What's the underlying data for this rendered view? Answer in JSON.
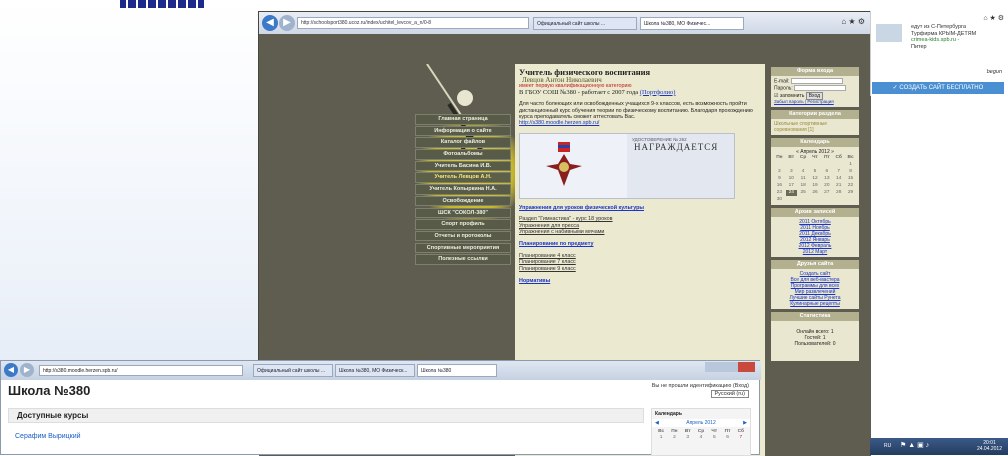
{
  "browser_main": {
    "url": "http://schoolsport380.ucoz.ru/index/uchitel_levcov_a_n/0-8",
    "tabs": [
      "Официальный сайт школы ...",
      "Школа №380, МО Физичес..."
    ],
    "page": {
      "menu": [
        "Главная страница",
        "Информация о сайте",
        "Каталог файлов",
        "Фотоальбомы",
        "Учитель Басина И.В.",
        "Учитель Левцов А.Н.",
        "Учитель Копыркина Н.А.",
        "Освобождение",
        "ШСК \"СОКОЛ-380\"",
        "Спорт профиль",
        "Отчеты и протоколы",
        "Спортивные мероприятия",
        "Полезные ссылки"
      ],
      "heading": "Учитель физического воспитания",
      "name": "Левцов Антон Николаевич",
      "category": "имеет первую квалификационную категорию",
      "work": "В ГБОУ СОШ №380 - работает с 2007 года",
      "portfolio": "(Портфолио)",
      "intro": "Для часто болеющих или освобожденных учащихся 9-х классов, есть возможность пройти дистанционный курс обучения теории по физическому воспитанию. Благодаря прохождению курса преподаватель сможет аттестовать Вас.",
      "moodle_link": "http://s380.moodle.herzen.spb.ru/",
      "cert_title": "НАГРАЖДАЕТСЯ",
      "cert_small": "УДОСТОВЕРЕНИЕ № 262",
      "section1": "Упражнения для уроков физической культуры",
      "links1": [
        "Раздел \"Гимнастика\" - курс 18 уроков",
        "Упражнения для пресса",
        "Упражнения с набивными мячами"
      ],
      "section2": "Планирование по предмету",
      "links2": [
        "Планирование 4 класс",
        "Планирование 7 класс",
        "Планирование 9 класс"
      ],
      "section3": "Нормативы"
    },
    "sidebar": {
      "login_header": "Форма входа",
      "email_label": "E-mail:",
      "password_label": "Пароль:",
      "remember": "запомнить",
      "login_btn": "Вход",
      "forgot": "Забыл пароль | Регистрация",
      "cat_header": "Категории раздела",
      "cat_item": "Школьные спортивные соревнования [1]",
      "cal_header": "Календарь",
      "cal_month": "« Апрель 2012 »",
      "cal_days": [
        "Пн",
        "Вт",
        "Ср",
        "Чт",
        "Пт",
        "Сб",
        "Вс"
      ],
      "cal_dates": [
        "",
        "",
        "",
        "",
        "",
        "",
        "1",
        "2",
        "3",
        "4",
        "5",
        "6",
        "7",
        "8",
        "9",
        "10",
        "11",
        "12",
        "13",
        "14",
        "15",
        "16",
        "17",
        "18",
        "19",
        "20",
        "21",
        "22",
        "23",
        "24",
        "25",
        "26",
        "27",
        "28",
        "29",
        "30"
      ],
      "cal_today": "24",
      "archive_header": "Архив записей",
      "archive": [
        "2011 Октябрь",
        "2011 Ноябрь",
        "2011 Декабрь",
        "2012 Январь",
        "2012 Февраль",
        "2012 Март"
      ],
      "friends_header": "Друзья сайта",
      "friends": [
        "Создать сайт",
        "Все для веб-мастера",
        "Программы для всех",
        "Мир развлечений",
        "Лучшие сайты Рунета",
        "Кулинарные рецепты"
      ],
      "stats_header": "Статистика",
      "online": "Онлайн всего: 1",
      "guests": "Гостей: 1",
      "users": "Пользователей: 0"
    }
  },
  "ad": {
    "text1": "едут из С-Петербурга",
    "text2": "Турфирма КРЫМ-ДЕТЯМ",
    "text3": "crimea-kids.spb.ru -",
    "text4": "Питер",
    "sig": "begun",
    "button": "СОЗДАТЬ САЙТ БЕСПЛАТНО"
  },
  "taskbar": {
    "lang": "RU",
    "time": "20:01",
    "date": "24.04.2012"
  },
  "browser_second": {
    "url": "http://s380.moodle.herzen.spb.ru/",
    "tabs": [
      "Официальный сайт школы ...",
      "Школа №380, МО Физическ...",
      "Школа №380"
    ],
    "title": "Школа №380",
    "login_note": "Вы не прошли идентификацию (Вход)",
    "lang_select": "Русский (ru)",
    "courses": "Доступные курсы",
    "course1": "Серафим Вырицкий",
    "calendar": "Календарь",
    "month": "Апрель 2012",
    "days": [
      "Вс",
      "Пн",
      "Вт",
      "Ср",
      "Чт",
      "Пт",
      "Сб"
    ],
    "first_week": [
      "1",
      "2",
      "3",
      "4",
      "5",
      "6",
      "7"
    ]
  }
}
